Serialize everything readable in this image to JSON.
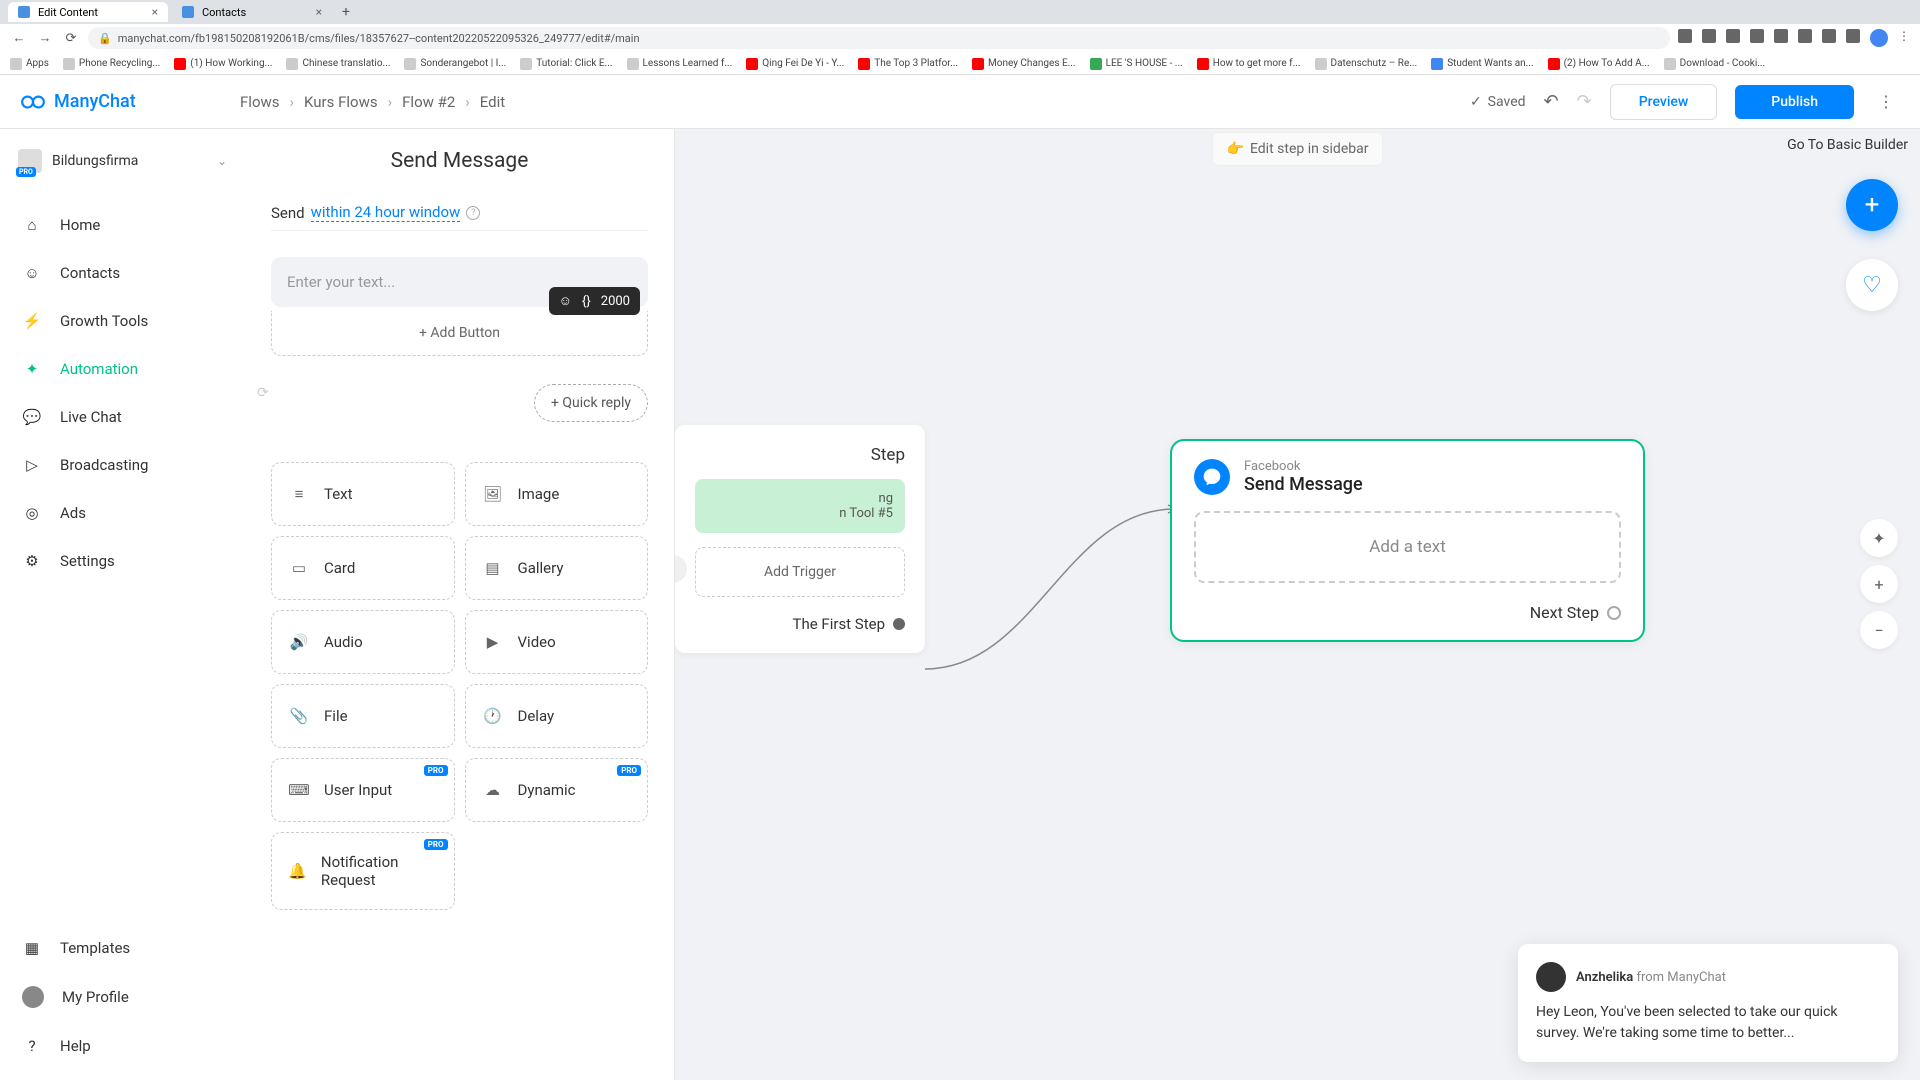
{
  "browser": {
    "tabs": [
      {
        "title": "Edit Content",
        "active": true
      },
      {
        "title": "Contacts",
        "active": false
      }
    ],
    "url": "manychat.com/fb198150208192061B/cms/files/18357627--content20220522095326_249777/edit#/main",
    "bookmarks": [
      "Apps",
      "Phone Recycling...",
      "(1) How Working...",
      "Chinese translatio...",
      "Sonderangebot | I...",
      "Tutorial: Click E...",
      "Lessons Learned f...",
      "Qing Fei De Yi - Y...",
      "The Top 3 Platfor...",
      "Money Changes E...",
      "LEE 'S HOUSE - ...",
      "How to get more f...",
      "Datenschutz – Re...",
      "Student Wants an...",
      "(2) How To Add A...",
      "Download - Cooki..."
    ]
  },
  "header": {
    "app_name": "ManyChat",
    "breadcrumbs": [
      "Flows",
      "Kurs Flows",
      "Flow #2",
      "Edit"
    ],
    "saved_label": "Saved",
    "preview_label": "Preview",
    "publish_label": "Publish"
  },
  "sidebar": {
    "org_name": "Bildungsfirma",
    "org_badge": "PRO",
    "items": [
      {
        "label": "Home"
      },
      {
        "label": "Contacts"
      },
      {
        "label": "Growth Tools"
      },
      {
        "label": "Automation",
        "active": true
      },
      {
        "label": "Live Chat"
      },
      {
        "label": "Broadcasting"
      },
      {
        "label": "Ads"
      },
      {
        "label": "Settings"
      }
    ],
    "bottom_items": [
      {
        "label": "Templates"
      },
      {
        "label": "My Profile"
      },
      {
        "label": "Help"
      }
    ]
  },
  "edit_panel": {
    "title": "Send Message",
    "send_prefix": "Send",
    "send_within": "within 24 hour window",
    "text_placeholder": "Enter your text...",
    "char_limit": "2000",
    "add_button_label": "+ Add Button",
    "quick_reply_label": "+ Quick reply",
    "blocks": [
      {
        "label": "Text"
      },
      {
        "label": "Image"
      },
      {
        "label": "Card"
      },
      {
        "label": "Gallery"
      },
      {
        "label": "Audio"
      },
      {
        "label": "Video"
      },
      {
        "label": "File"
      },
      {
        "label": "Delay"
      },
      {
        "label": "User Input",
        "pro": true
      },
      {
        "label": "Dynamic",
        "pro": true
      },
      {
        "label": "Notification Request",
        "pro": true
      }
    ],
    "pro_badge": "PRO"
  },
  "canvas": {
    "edit_sidebar_label": "Edit step in sidebar",
    "goto_basic_label": "Go To Basic Builder",
    "partial_step": {
      "title": "Step",
      "green_line1": "ng",
      "green_line2": "n Tool #5",
      "add_trigger": "Add Trigger",
      "first_step": "The First Step"
    },
    "node": {
      "platform": "Facebook",
      "title": "Send Message",
      "add_text": "Add a text",
      "next_step": "Next Step"
    }
  },
  "chat": {
    "name": "Anzhelika",
    "from": "from ManyChat",
    "body": "Hey Leon,  You've been selected to take our quick survey. We're taking some time to better..."
  }
}
